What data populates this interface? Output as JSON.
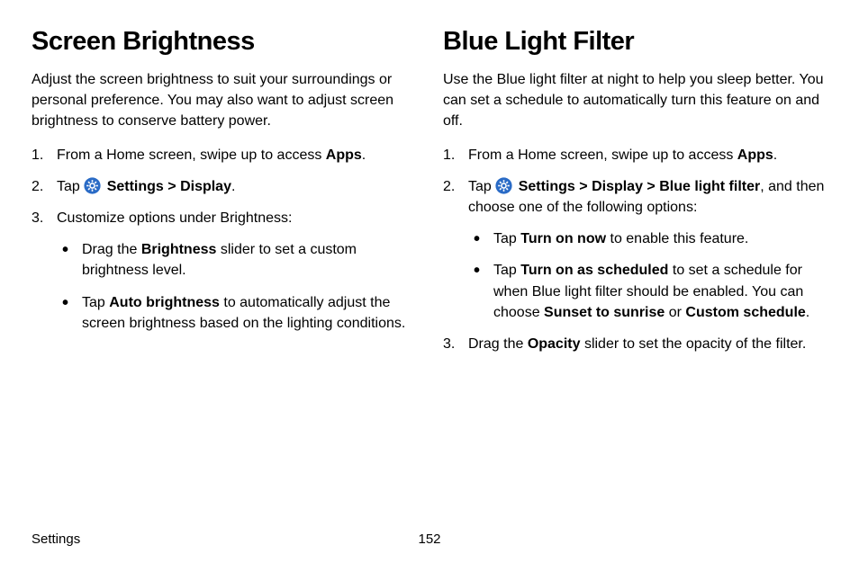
{
  "left": {
    "title": "Screen Brightness",
    "intro": "Adjust the screen brightness to suit your surroundings or personal preference. You may also want to adjust screen brightness to conserve battery power.",
    "step1_a": "From a Home screen, swipe up to access ",
    "step1_b": "Apps",
    "step1_c": ".",
    "step2_a": "Tap ",
    "step2_b": "Settings",
    "step2_c": " > ",
    "step2_d": "Display",
    "step2_e": ".",
    "step3": "Customize options under Brightness:",
    "b1_a": "Drag the ",
    "b1_b": "Brightness",
    "b1_c": " slider to set a custom brightness level.",
    "b2_a": "Tap ",
    "b2_b": "Auto brightness",
    "b2_c": " to automatically adjust the screen brightness based on the lighting conditions."
  },
  "right": {
    "title": "Blue Light Filter",
    "intro": "Use the Blue light filter at night to help you sleep better. You can set a schedule to automatically turn this feature on and off.",
    "step1_a": "From a Home screen, swipe up to access ",
    "step1_b": "Apps",
    "step1_c": ".",
    "step2_a": "Tap ",
    "step2_b": "Settings",
    "step2_c": " > ",
    "step2_d": "Display",
    "step2_e": " > ",
    "step2_f": "Blue light filter",
    "step2_g": ", and then choose one of the following options:",
    "b1_a": "Tap ",
    "b1_b": "Turn on now",
    "b1_c": " to enable this feature.",
    "b2_a": "Tap ",
    "b2_b": "Turn on as scheduled",
    "b2_c": " to set a schedule for when Blue light filter should be enabled. You can choose ",
    "b2_d": "Sunset to sunrise",
    "b2_e": " or ",
    "b2_f": "Custom schedule",
    "b2_g": ".",
    "step3_a": "Drag the ",
    "step3_b": "Opacity",
    "step3_c": " slider to set the opacity of the filter."
  },
  "footer": {
    "section": "Settings",
    "page": "152"
  }
}
